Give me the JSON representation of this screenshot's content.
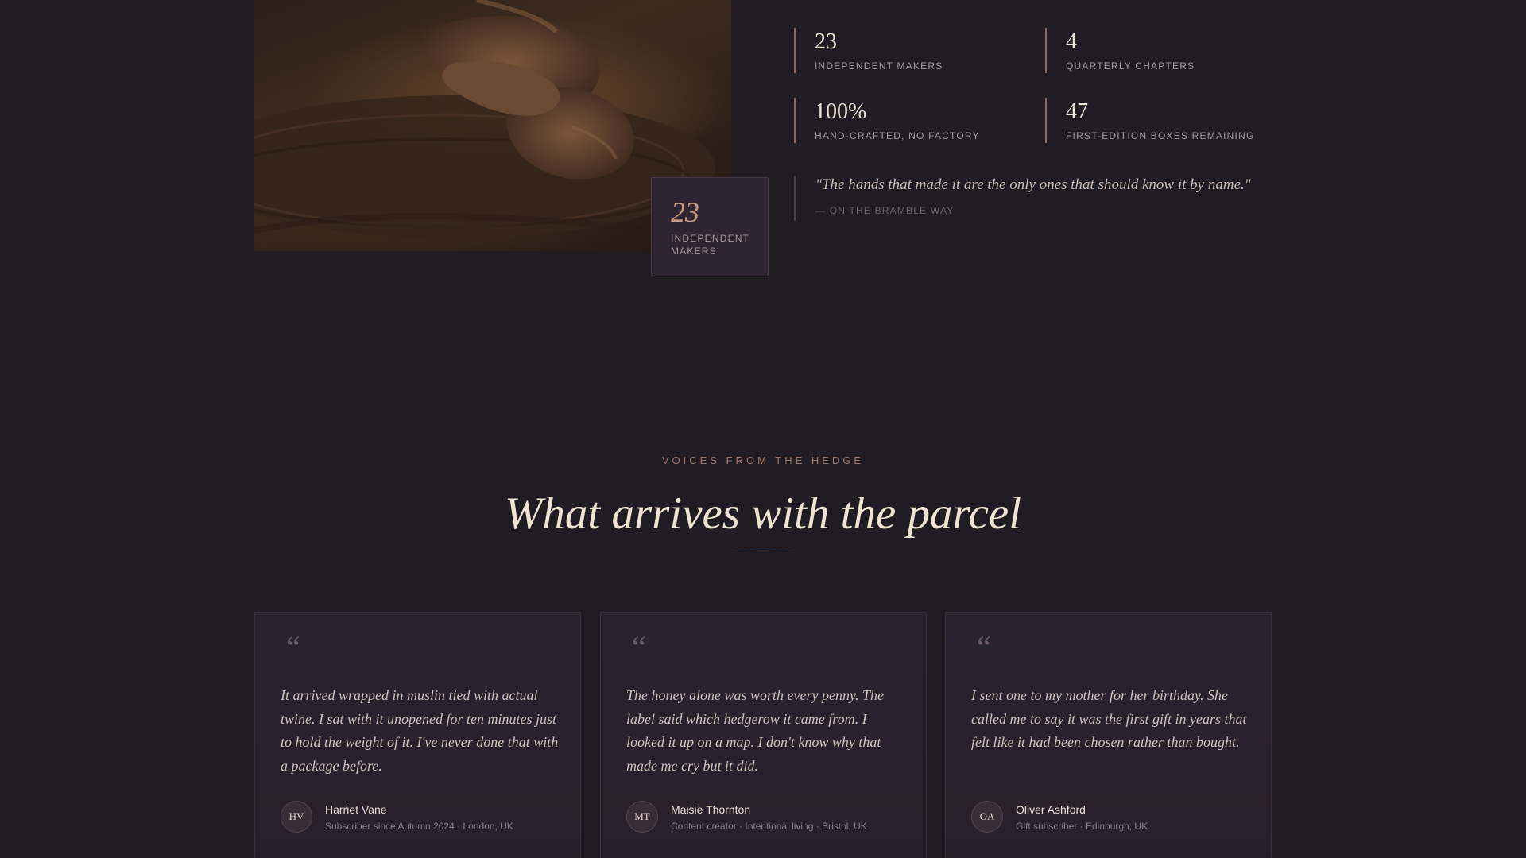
{
  "story": {
    "badge": {
      "number": "23",
      "label": "Independent Makers"
    },
    "stats": [
      {
        "value": "23",
        "label": "Independent Makers"
      },
      {
        "value": "4",
        "label": "Quarterly Chapters"
      },
      {
        "value": "100%",
        "label": "Hand-crafted, no factory"
      },
      {
        "value": "47",
        "label": "First-edition boxes remaining"
      }
    ],
    "quote": {
      "text": "\"The hands that made it are the only ones that should know it by name.\"",
      "attribution": "— On the Bramble Way"
    }
  },
  "testimonials": {
    "eyebrow": "Voices from the hedge",
    "title": "What arrives with the parcel",
    "quote_mark": "“",
    "items": [
      {
        "text": "It arrived wrapped in muslin tied with actual twine. I sat with it unopened for ten minutes just to hold the weight of it. I've never done that with a package before.",
        "initials": "HV",
        "name": "Harriet Vane",
        "meta": "Subscriber since Autumn 2024 · London, UK"
      },
      {
        "text": "The honey alone was worth every penny. The label said which hedgerow it came from. I looked it up on a map. I don't know why that made me cry but it did.",
        "initials": "MT",
        "name": "Maisie Thornton",
        "meta": "Content creator · Intentional living · Bristol, UK"
      },
      {
        "text": "I sent one to my mother for her birthday. She called me to say it was the first gift in years that felt like it had been chosen rather than bought.",
        "initials": "OA",
        "name": "Oliver Ashford",
        "meta": "Gift subscriber · Edinburgh, UK"
      }
    ]
  },
  "colors": {
    "background": "#211b23",
    "accent": "#c69a80",
    "card": "#2b2230"
  }
}
